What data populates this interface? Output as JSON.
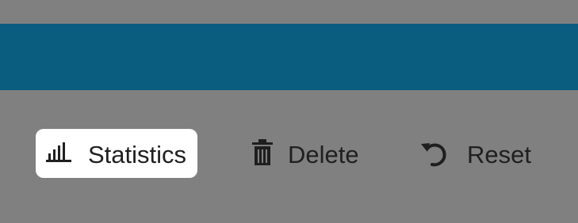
{
  "toolbar": {
    "actions": [
      {
        "label": "Statistics",
        "icon": "bar-chart-icon",
        "selected": true
      },
      {
        "label": "Delete",
        "icon": "trash-icon",
        "selected": false
      },
      {
        "label": "Reset",
        "icon": "undo-icon",
        "selected": false
      }
    ]
  },
  "colors": {
    "background": "#808080",
    "top_bar": "#0b5d7f",
    "selected_button": "#ffffff",
    "text": "#1f1f1f"
  }
}
